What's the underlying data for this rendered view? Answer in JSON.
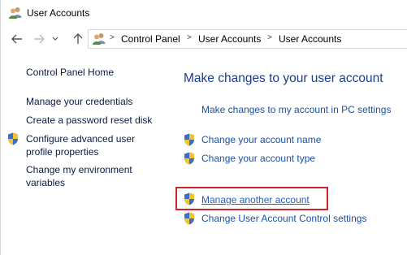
{
  "window": {
    "title": "User Accounts"
  },
  "navigation": {
    "back_icon": "arrow-left-icon",
    "forward_icon": "arrow-right-icon",
    "dropdown_icon": "chevron-down-icon",
    "up_icon": "arrow-up-icon",
    "breadcrumb_separator": ">",
    "breadcrumbs": [
      {
        "label": "Control Panel"
      },
      {
        "label": "User Accounts"
      },
      {
        "label": "User Accounts"
      }
    ]
  },
  "sidebar": {
    "items": [
      {
        "label": "Control Panel Home",
        "icon": null
      },
      {
        "label": "Manage your credentials",
        "icon": null
      },
      {
        "label": "Create a password reset disk",
        "icon": null
      },
      {
        "label": "Configure advanced user profile properties",
        "icon": "uac-shield-icon"
      },
      {
        "label": "Change my environment variables",
        "icon": null
      }
    ]
  },
  "main": {
    "heading": "Make changes to your user account",
    "links": [
      {
        "label": "Make changes to my account in PC settings",
        "icon": null
      },
      {
        "label": "Change your account name",
        "icon": "uac-shield-icon"
      },
      {
        "label": "Change your account type",
        "icon": "uac-shield-icon"
      },
      {
        "label": "Manage another account",
        "icon": "uac-shield-icon",
        "highlighted": true
      },
      {
        "label": "Change User Account Control settings",
        "icon": "uac-shield-icon"
      }
    ]
  },
  "colors": {
    "heading": "#1a3d8f",
    "link": "#1a52a8",
    "sidebar_link": "#0a1a45",
    "highlight_border": "#d2232a"
  }
}
